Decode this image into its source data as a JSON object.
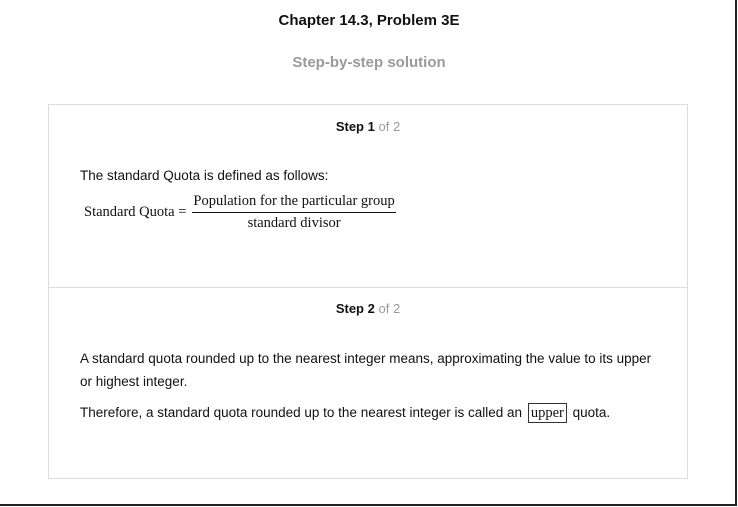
{
  "header": {
    "title": "Chapter 14.3, Problem 3E",
    "subtitle": "Step-by-step solution"
  },
  "steps": [
    {
      "label": "Step",
      "number": "1",
      "of_text": "of 2",
      "definition": "The standard Quota is defined as follows:",
      "formula": {
        "lhs": "Standard Quota =",
        "numerator": "Population for the particular group",
        "denominator": "standard divisor"
      }
    },
    {
      "label": "Step",
      "number": "2",
      "of_text": "of 2",
      "paragraph1": "A standard quota rounded up to the nearest integer means, approximating the value to its upper or highest integer.",
      "paragraph2_before": "Therefore, a standard quota rounded up to the nearest integer is called an",
      "answer": "upper",
      "paragraph2_after": "quota."
    }
  ]
}
